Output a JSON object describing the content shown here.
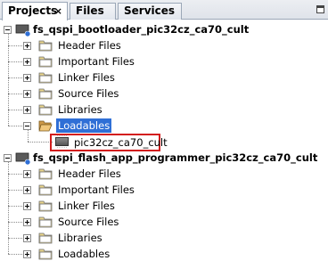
{
  "tabs": [
    {
      "label": "Projects",
      "active": true,
      "closable": true
    },
    {
      "label": "Files",
      "active": false
    },
    {
      "label": "Services",
      "active": false
    }
  ],
  "close_glyph": "×",
  "projects": [
    {
      "name": "fs_qspi_bootloader_pic32cz_ca70_cult",
      "icon": "project-chip-icon",
      "expanded": true,
      "children": [
        {
          "label": "Header Files",
          "icon": "folder-icon",
          "expanded": false
        },
        {
          "label": "Important Files",
          "icon": "folder-icon",
          "expanded": false
        },
        {
          "label": "Linker Files",
          "icon": "folder-icon",
          "expanded": false
        },
        {
          "label": "Source Files",
          "icon": "folder-icon",
          "expanded": false
        },
        {
          "label": "Libraries",
          "icon": "folder-icon",
          "expanded": false
        },
        {
          "label": "Loadables",
          "icon": "folder-open-icon",
          "expanded": true,
          "selected": true,
          "children": [
            {
              "label": "pic32cz_ca70_cult",
              "icon": "chip-icon",
              "highlighted": true
            }
          ]
        }
      ]
    },
    {
      "name": "fs_qspi_flash_app_programmer_pic32cz_ca70_cult",
      "icon": "project-chip-icon",
      "expanded": true,
      "children": [
        {
          "label": "Header Files",
          "icon": "folder-icon",
          "expanded": false
        },
        {
          "label": "Important Files",
          "icon": "folder-icon",
          "expanded": false
        },
        {
          "label": "Linker Files",
          "icon": "folder-icon",
          "expanded": false
        },
        {
          "label": "Source Files",
          "icon": "folder-icon",
          "expanded": false
        },
        {
          "label": "Libraries",
          "icon": "folder-icon",
          "expanded": false
        },
        {
          "label": "Loadables",
          "icon": "folder-icon",
          "expanded": false
        }
      ]
    }
  ],
  "colors": {
    "selection": "#2f6fd6",
    "highlight_border": "#d31d1d",
    "folder": "#e8d48a",
    "folder_open": "#cf9a48"
  }
}
